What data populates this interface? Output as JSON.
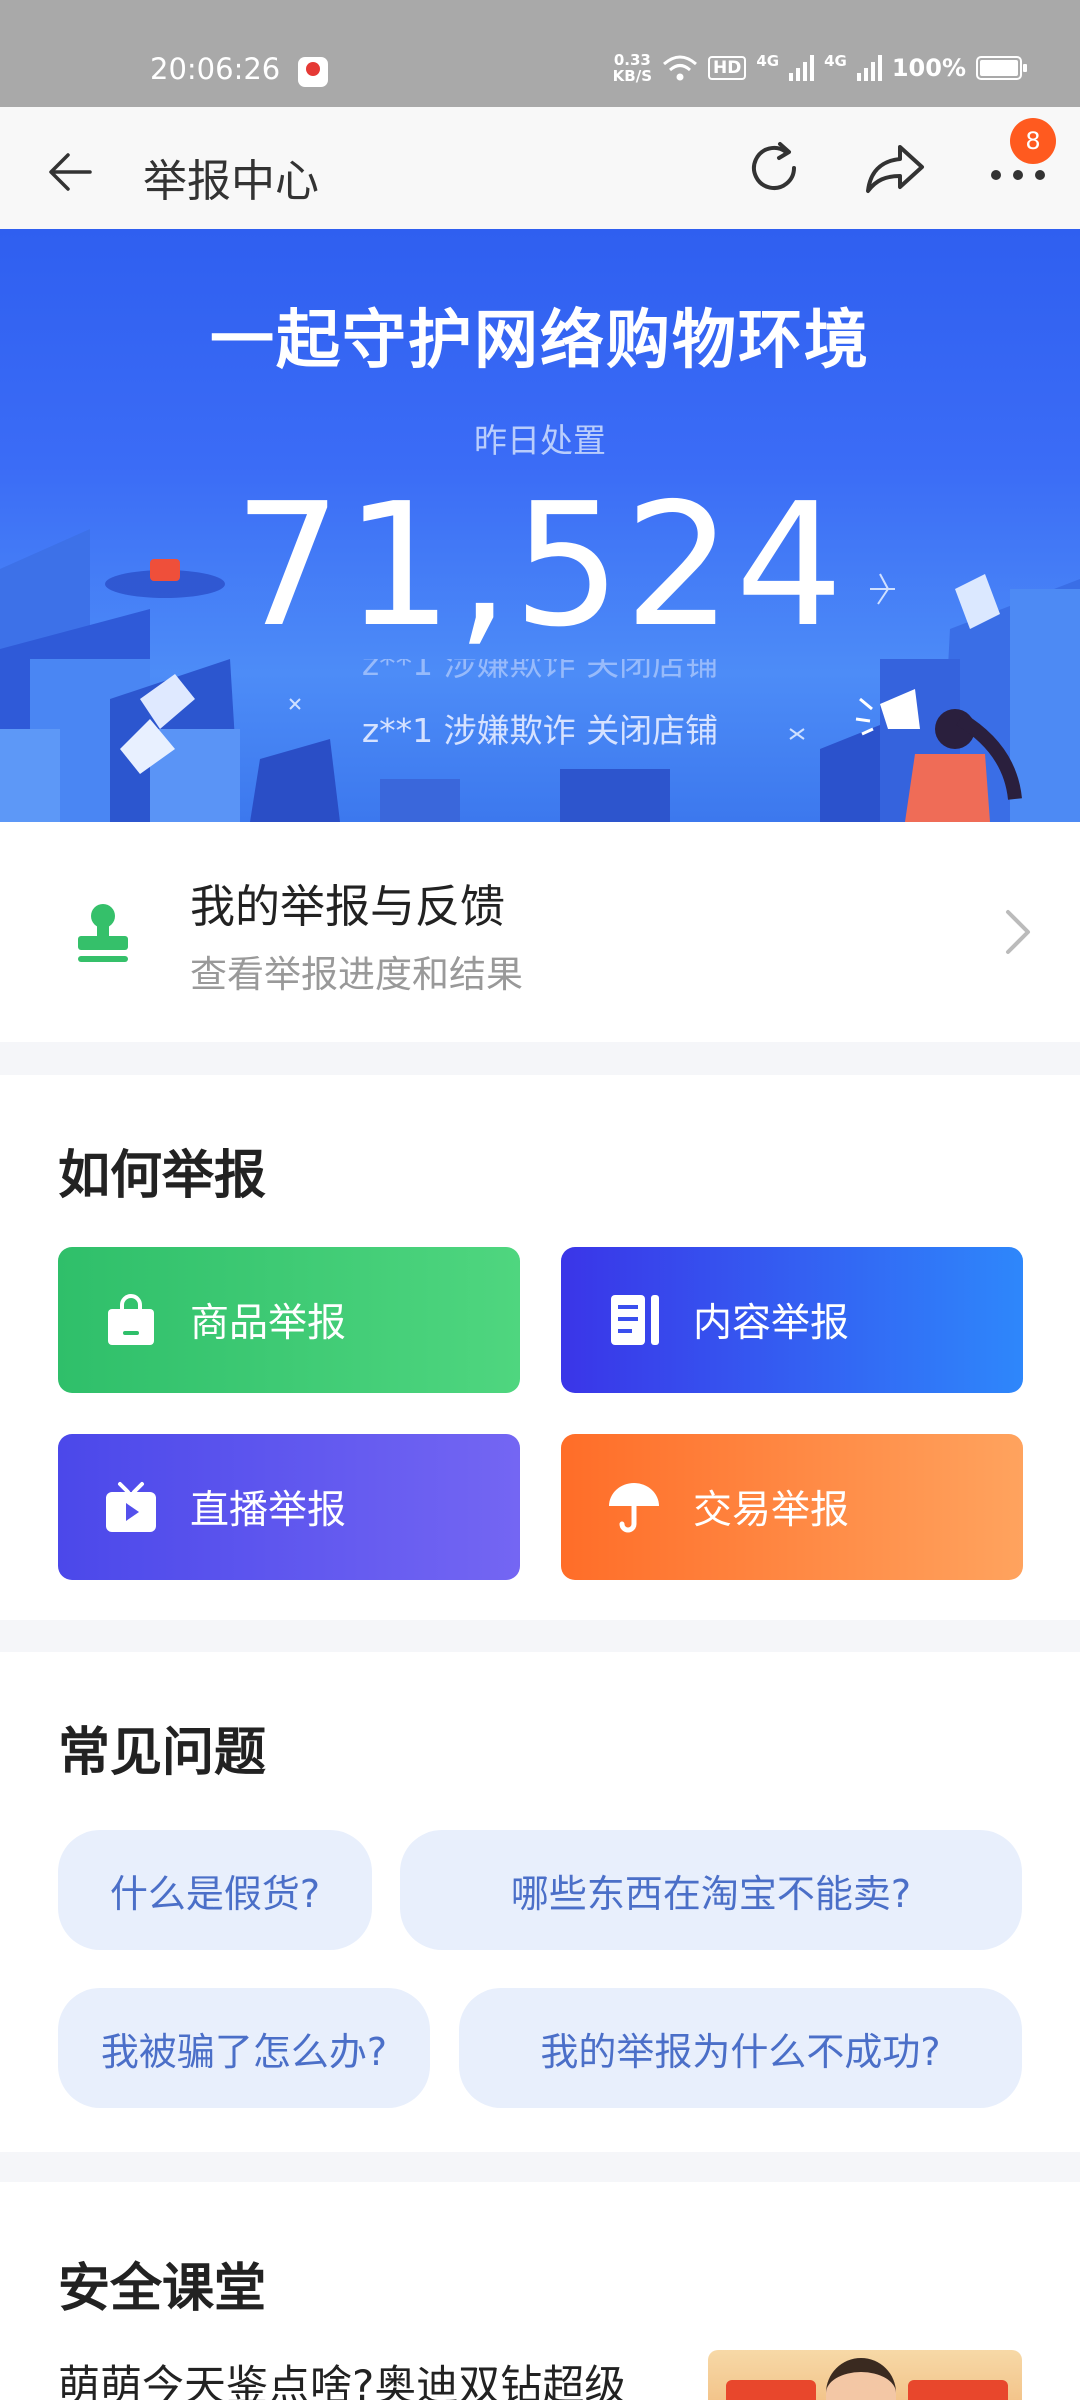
{
  "status_bar": {
    "time": "20:06:26",
    "net_speed_value": "0.33",
    "net_speed_unit": "KB/S",
    "hd_label": "HD",
    "sim1": "4G",
    "sim2": "4G",
    "battery": "100%"
  },
  "nav": {
    "title": "举报中心",
    "badge_count": "8"
  },
  "banner": {
    "slogan": "一起守护网络购物环境",
    "subtitle": "昨日处置",
    "count": "71,524",
    "ticker_previous": "z**1 涉嫌欺诈 关闭店铺",
    "ticker": "z**1 涉嫌欺诈 关闭店铺"
  },
  "my_report": {
    "title": "我的举报与反馈",
    "subtitle": "查看举报进度和结果"
  },
  "how_to_report": {
    "title": "如何举报",
    "buttons": [
      {
        "label": "商品举报",
        "icon": "shopping-bag-icon"
      },
      {
        "label": "内容举报",
        "icon": "document-icon"
      },
      {
        "label": "直播举报",
        "icon": "tv-icon"
      },
      {
        "label": "交易举报",
        "icon": "umbrella-icon"
      }
    ]
  },
  "faq": {
    "title": "常见问题",
    "items": [
      "什么是假货?",
      "哪些东西在淘宝不能卖?",
      "我被骗了怎么办?",
      "我的举报为什么不成功?"
    ]
  },
  "safety": {
    "title": "安全课堂",
    "article_title": "萌萌今天鉴点啥?奥迪双钻超级"
  }
}
